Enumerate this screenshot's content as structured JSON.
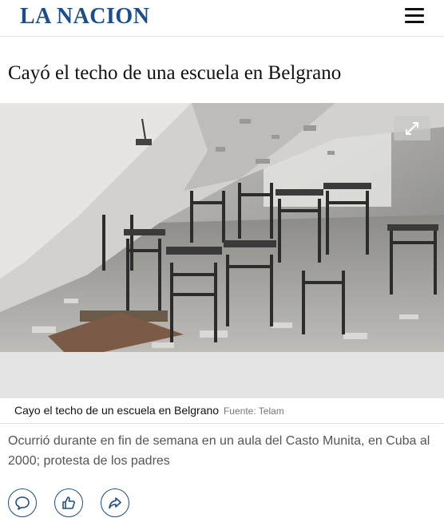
{
  "header": {
    "logo": "LA NACION",
    "menu_icon": "hamburger-menu-icon"
  },
  "article": {
    "title": "Cayó el techo de una escuela en Belgrano",
    "media": {
      "expand_icon": "expand-icon"
    },
    "caption": "Cayo el techo de un escuela en Belgrano",
    "source": "Fuente: Telam",
    "summary": "Ocurrió durante en fin de semana en un aula del Casto Munita, en Cuba al 2000; protesta de los padres"
  },
  "actions": [
    {
      "icon": "comment-icon"
    },
    {
      "icon": "thumbs-up-icon"
    },
    {
      "icon": "share-icon"
    }
  ],
  "colors": {
    "brand": "#1b4d8a",
    "summary_text": "#555555"
  }
}
